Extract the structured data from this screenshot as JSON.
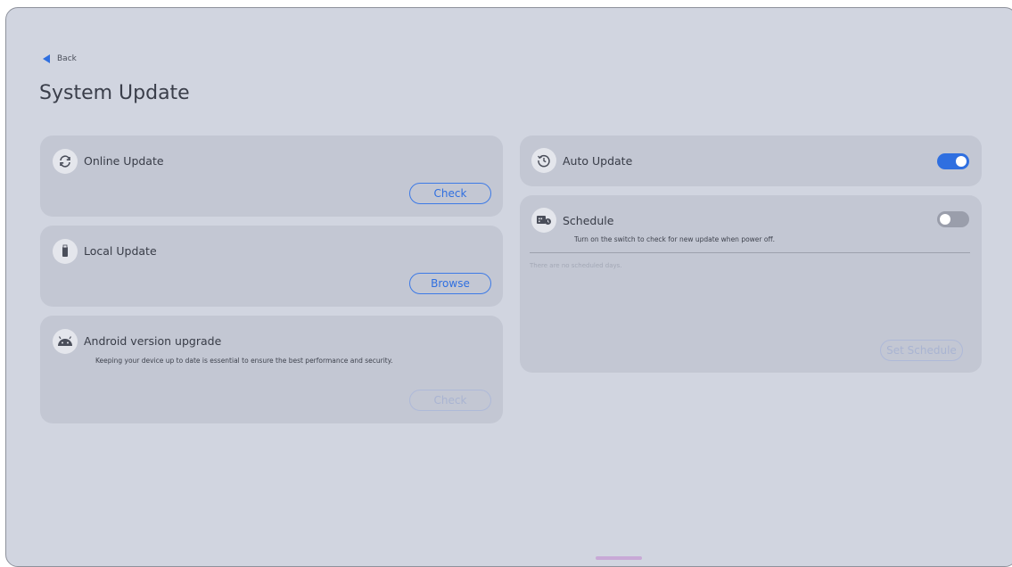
{
  "header": {
    "back_label": "Back",
    "title": "System Update"
  },
  "online_update": {
    "label": "Online Update",
    "button": "Check"
  },
  "local_update": {
    "label": "Local Update",
    "button": "Browse"
  },
  "android_upgrade": {
    "label": "Android version upgrade",
    "description": "Keeping your device up to date is essential to ensure the best performance and security.",
    "button": "Check",
    "button_disabled": true
  },
  "auto_update": {
    "label": "Auto Update",
    "enabled": true
  },
  "schedule": {
    "label": "Schedule",
    "description": "Turn on the switch to check for new update when power off.",
    "enabled": false,
    "empty_text": "There are no scheduled days.",
    "button": "Set Schedule",
    "button_disabled": true
  },
  "colors": {
    "accent": "#2f6fe0",
    "background": "#d1d5e0",
    "card": "#c3c7d3"
  }
}
